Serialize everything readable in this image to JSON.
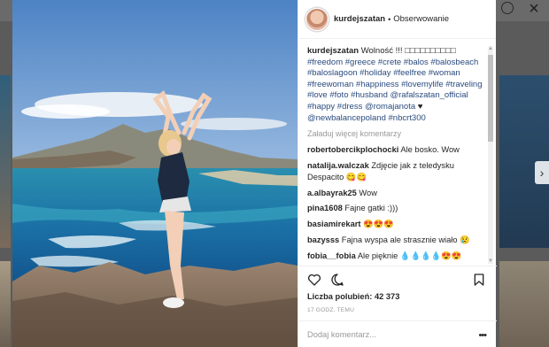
{
  "post": {
    "username": "kurdejszatan",
    "separator": "•",
    "follow_status": "Obserwowanie",
    "caption_user": "kurdejszatan",
    "caption_text": "Wolność !!! ",
    "caption_emoji": "□□□□□□□□□□",
    "hashtags_1": "#freedom #greece #crete #balos #balosbeach #baloslagoon #holiday #feelfree #woman #freewoman #happiness #lovemylife #traveling #love #foto #husband @rafalszatan_official #happy #dress @romajanota",
    "heart": "♥",
    "hashtags_2": "@newbalancepoland #nbcrt300",
    "load_more": "Załaduj więcej komentarzy",
    "likes_label": "Liczba polubień:",
    "likes_count": "42 373",
    "timestamp": "17 GODZ. TEMU",
    "add_comment_placeholder": "Dodaj komentarz...",
    "more_label": "•••"
  },
  "comments": [
    {
      "user": "robertobercikplochocki",
      "text": "Ale bosko. Wow"
    },
    {
      "user": "natalija.walczak",
      "text": "Zdjęcie jak z teledysku Despacito 😋😋"
    },
    {
      "user": "a.albayrak25",
      "text": "Wow"
    },
    {
      "user": "pina1608",
      "text": "Fajne gatki :)))"
    },
    {
      "user": "basiamirekart",
      "text": "😍😍😍"
    },
    {
      "user": "bazysss",
      "text": "Fajna wyspa ale strasznie wiało 😢"
    },
    {
      "user": "fobia__fobia",
      "text": "Ale pięknie 💧💧💧💧😍😍"
    }
  ],
  "icons": {
    "like": "heart-outline-icon",
    "comment": "speech-bubble-icon",
    "save": "bookmark-icon",
    "close": "close-icon",
    "next": "chevron-right-icon"
  },
  "nav": {
    "close_glyph": "×",
    "next_glyph": "›"
  }
}
